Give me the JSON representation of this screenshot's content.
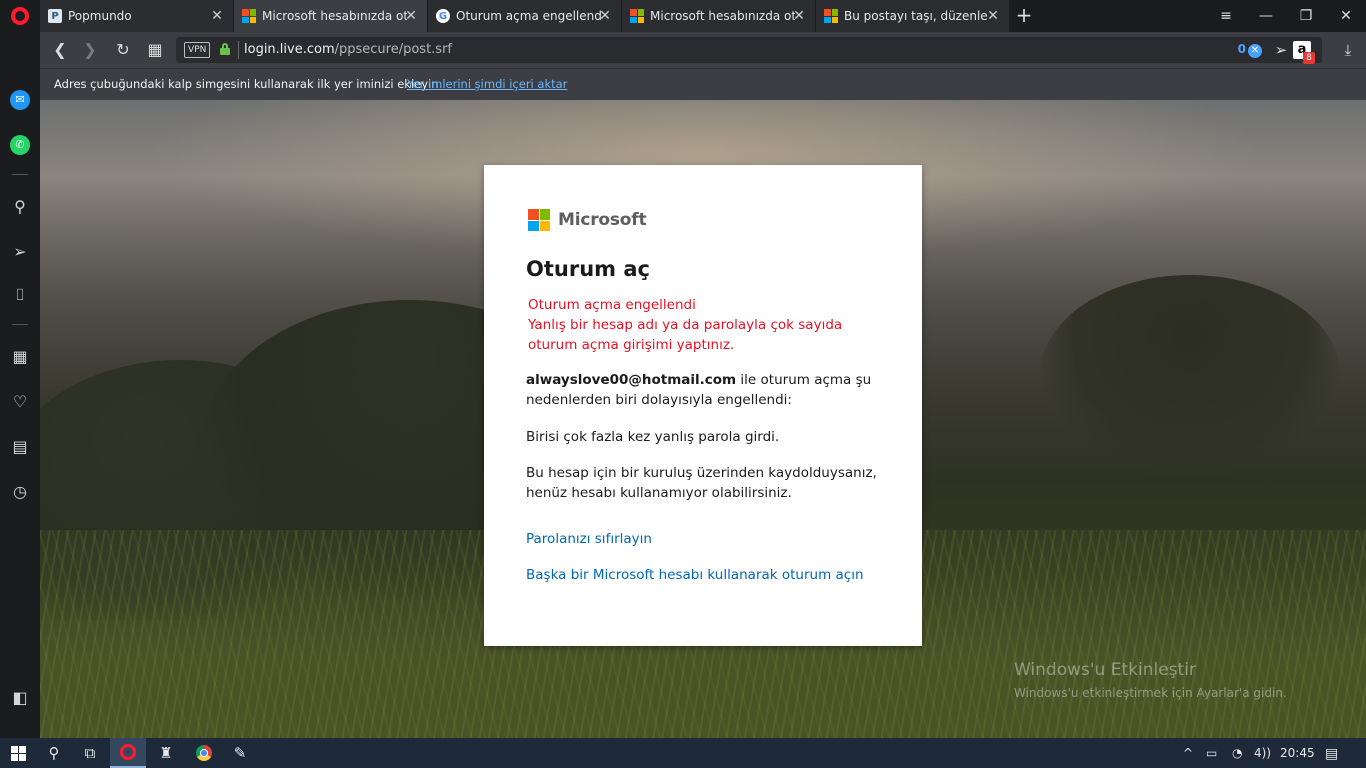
{
  "browser": {
    "tabs": [
      {
        "title": "Popmundo",
        "favicon": "popmundo-icon"
      },
      {
        "title": "Microsoft hesabınızda oturum açın",
        "favicon": "microsoft-icon",
        "active": true
      },
      {
        "title": "Oturum açma engellendi YouTube",
        "favicon": "google-icon"
      },
      {
        "title": "Microsoft hesabınızda oturum açın",
        "favicon": "microsoft-icon"
      },
      {
        "title": "Bu postayı taşı, düzenle ve sil",
        "favicon": "microsoft-icon"
      }
    ],
    "url_host": "login.live.com",
    "url_path": "/ppsecure/post.srf",
    "vpn_label": "VPN",
    "adblock_count": "0",
    "extension_badge": "8",
    "bookmark_hint": "Adres çubuğundaki kalp simgesini kullanarak ilk yer iminizi ekleyin",
    "bookmark_hint_link": "Yer imlerini şimdi içeri aktar"
  },
  "signin": {
    "brand": "Microsoft",
    "title": "Oturum aç",
    "error_line1": "Oturum açma engellendi",
    "error_line2": "Yanlış bir hesap adı ya da parolayla çok sayıda oturum açma girişimi yaptınız.",
    "account_email": "alwayslove00@hotmail.com",
    "account_suffix": " ile oturum açma şu nedenlerden biri dolayısıyla engellendi:",
    "reason1": "Birisi çok fazla kez yanlış parola girdi.",
    "reason2": "Bu hesap için bir kuruluş üzerinden kaydolduysanız, henüz hesabı kullanamıyor olabilirsiniz.",
    "reset_link": "Parolanızı sıfırlayın",
    "other_account_link": "Başka bir Microsoft hesabı kullanarak oturum açın"
  },
  "watermark": {
    "title": "Windows'u Etkinleştir",
    "subtitle": "Windows'u etkinleştirmek için Ayarlar'a gidin."
  },
  "taskbar": {
    "clock": "20:45",
    "volume_label": "4))"
  },
  "colors": {
    "error_red": "#e81123",
    "link_blue": "#0067b8",
    "opera_red": "#ff1b2d"
  }
}
